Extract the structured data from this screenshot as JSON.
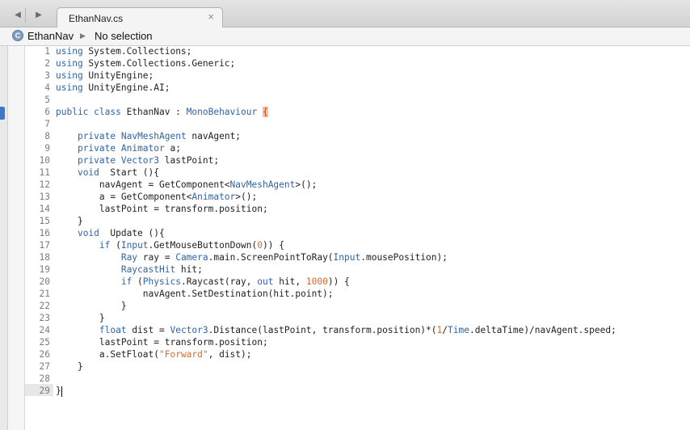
{
  "tabbar": {
    "back_glyph": "◀",
    "forward_glyph": "▶",
    "active_tab": {
      "label": "EthanNav.cs",
      "close_glyph": "×"
    }
  },
  "pathbar": {
    "class_icon_letter": "C",
    "class_name": "EthanNav",
    "separator_glyph": "▶",
    "member": "No selection"
  },
  "colors": {
    "keyword": "#2f64a6",
    "string": "#d86a2c",
    "brace_highlight": "#f7c296",
    "gutter_marker": "#3c78c8"
  },
  "editor": {
    "cursor_line": 29,
    "lines": [
      {
        "n": "1",
        "parts": [
          {
            "t": "using",
            "c": "kw"
          },
          {
            "t": " System.Collections;"
          }
        ]
      },
      {
        "n": "2",
        "parts": [
          {
            "t": "using",
            "c": "kw"
          },
          {
            "t": " System.Collections.Generic;"
          }
        ]
      },
      {
        "n": "3",
        "parts": [
          {
            "t": "using",
            "c": "kw"
          },
          {
            "t": " UnityEngine;"
          }
        ]
      },
      {
        "n": "4",
        "parts": [
          {
            "t": "using",
            "c": "kw"
          },
          {
            "t": " UnityEngine.AI;"
          }
        ]
      },
      {
        "n": "5",
        "parts": []
      },
      {
        "n": "6",
        "parts": [
          {
            "t": "public class",
            "c": "kw"
          },
          {
            "t": " EthanNav : "
          },
          {
            "t": "MonoBehaviour",
            "c": "ty"
          },
          {
            "t": " "
          },
          {
            "t": "{",
            "c": "brace-hl"
          }
        ]
      },
      {
        "n": "7",
        "parts": []
      },
      {
        "n": "8",
        "parts": [
          {
            "t": "    "
          },
          {
            "t": "private",
            "c": "kw"
          },
          {
            "t": " "
          },
          {
            "t": "NavMeshAgent",
            "c": "ty"
          },
          {
            "t": " navAgent;"
          }
        ]
      },
      {
        "n": "9",
        "parts": [
          {
            "t": "    "
          },
          {
            "t": "private",
            "c": "kw"
          },
          {
            "t": " "
          },
          {
            "t": "Animator",
            "c": "ty"
          },
          {
            "t": " a;"
          }
        ]
      },
      {
        "n": "10",
        "parts": [
          {
            "t": "    "
          },
          {
            "t": "private",
            "c": "kw"
          },
          {
            "t": " "
          },
          {
            "t": "Vector3",
            "c": "ty"
          },
          {
            "t": " lastPoint;"
          }
        ]
      },
      {
        "n": "11",
        "parts": [
          {
            "t": "    "
          },
          {
            "t": "void",
            "c": "kw"
          },
          {
            "t": "  Start (){"
          }
        ]
      },
      {
        "n": "12",
        "parts": [
          {
            "t": "        navAgent = GetComponent<"
          },
          {
            "t": "NavMeshAgent",
            "c": "ty"
          },
          {
            "t": ">();"
          }
        ]
      },
      {
        "n": "13",
        "parts": [
          {
            "t": "        a = GetComponent<"
          },
          {
            "t": "Animator",
            "c": "ty"
          },
          {
            "t": ">();"
          }
        ]
      },
      {
        "n": "14",
        "parts": [
          {
            "t": "        lastPoint = transform.position;"
          }
        ]
      },
      {
        "n": "15",
        "parts": [
          {
            "t": "    }"
          }
        ]
      },
      {
        "n": "16",
        "parts": [
          {
            "t": "    "
          },
          {
            "t": "void",
            "c": "kw"
          },
          {
            "t": "  Update (){"
          }
        ]
      },
      {
        "n": "17",
        "parts": [
          {
            "t": "        "
          },
          {
            "t": "if",
            "c": "kw"
          },
          {
            "t": " ("
          },
          {
            "t": "Input",
            "c": "ty"
          },
          {
            "t": ".GetMouseButtonDown("
          },
          {
            "t": "0",
            "c": "num"
          },
          {
            "t": ")) {"
          }
        ]
      },
      {
        "n": "18",
        "parts": [
          {
            "t": "            "
          },
          {
            "t": "Ray",
            "c": "ty"
          },
          {
            "t": " ray = "
          },
          {
            "t": "Camera",
            "c": "ty"
          },
          {
            "t": ".main.ScreenPointToRay("
          },
          {
            "t": "Input",
            "c": "ty"
          },
          {
            "t": ".mousePosition);"
          }
        ]
      },
      {
        "n": "19",
        "parts": [
          {
            "t": "            "
          },
          {
            "t": "RaycastHit",
            "c": "ty"
          },
          {
            "t": " hit;"
          }
        ]
      },
      {
        "n": "20",
        "parts": [
          {
            "t": "            "
          },
          {
            "t": "if",
            "c": "kw"
          },
          {
            "t": " ("
          },
          {
            "t": "Physics",
            "c": "ty"
          },
          {
            "t": ".Raycast(ray, "
          },
          {
            "t": "out",
            "c": "kw"
          },
          {
            "t": " hit, "
          },
          {
            "t": "1000",
            "c": "num"
          },
          {
            "t": ")) {"
          }
        ]
      },
      {
        "n": "21",
        "parts": [
          {
            "t": "                navAgent.SetDestination(hit.point);"
          }
        ]
      },
      {
        "n": "22",
        "parts": [
          {
            "t": "            }"
          }
        ]
      },
      {
        "n": "23",
        "parts": [
          {
            "t": "        }"
          }
        ]
      },
      {
        "n": "24",
        "parts": [
          {
            "t": "        "
          },
          {
            "t": "float",
            "c": "kw"
          },
          {
            "t": " dist = "
          },
          {
            "t": "Vector3",
            "c": "ty"
          },
          {
            "t": ".Distance(lastPoint, transform.position)*("
          },
          {
            "t": "1",
            "c": "num"
          },
          {
            "t": "/"
          },
          {
            "t": "Time",
            "c": "ty"
          },
          {
            "t": ".deltaTime)/navAgent.speed;"
          }
        ]
      },
      {
        "n": "25",
        "parts": [
          {
            "t": "        lastPoint = transform.position;"
          }
        ]
      },
      {
        "n": "26",
        "parts": [
          {
            "t": "        a.SetFloat("
          },
          {
            "t": "\"Forward\"",
            "c": "str"
          },
          {
            "t": ", dist);"
          }
        ]
      },
      {
        "n": "27",
        "parts": [
          {
            "t": "    }"
          }
        ]
      },
      {
        "n": "28",
        "parts": []
      },
      {
        "n": "29",
        "parts": [
          {
            "t": "}"
          }
        ]
      }
    ]
  }
}
